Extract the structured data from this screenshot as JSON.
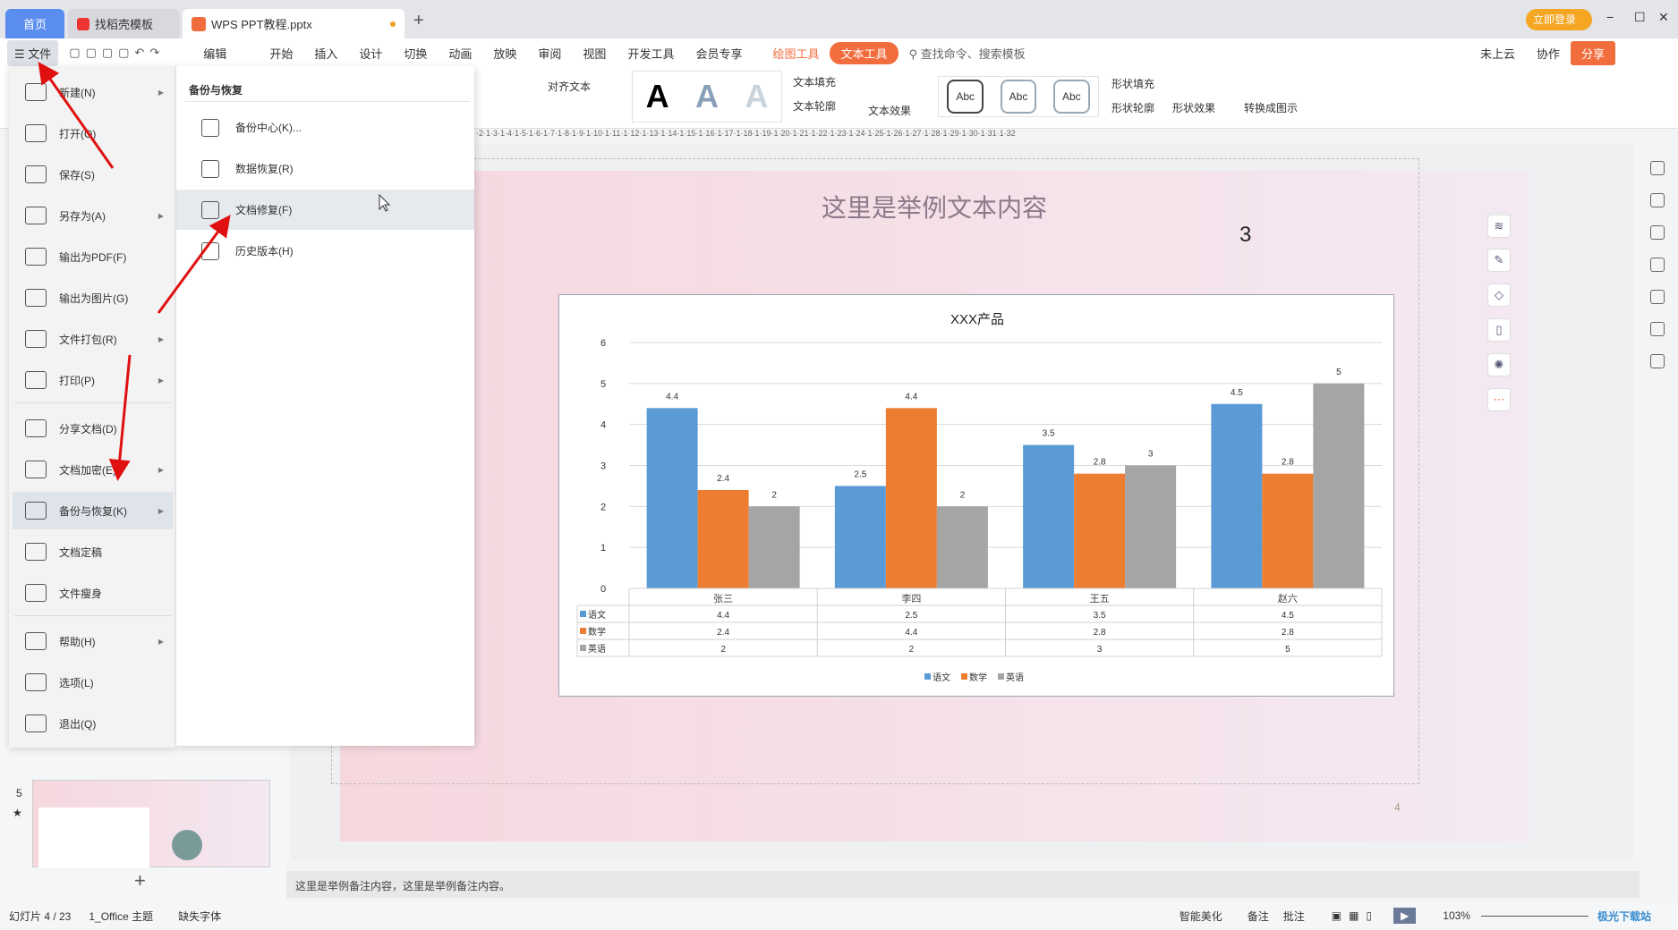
{
  "tabs": {
    "home": "首页",
    "template": "找稻壳模板",
    "doc": "WPS PPT教程.pptx",
    "new_tab": "+"
  },
  "window": {
    "login": "立即登录",
    "minimize": "−",
    "maximize": "☐",
    "close": "✕"
  },
  "menubar": {
    "file": "文件",
    "edit": "编辑",
    "items": [
      "开始",
      "插入",
      "设计",
      "切换",
      "动画",
      "放映",
      "审阅",
      "视图",
      "开发工具",
      "会员专享"
    ],
    "drawing_tools": "绘图工具",
    "text_tools": "文本工具",
    "search": "查找命令、搜索模板",
    "cloud": "未上云",
    "collab": "协作",
    "share": "分享"
  },
  "ribbon": {
    "align_text": "对齐文本",
    "text_fill": "文本填充",
    "text_outline": "文本轮廓",
    "text_effect": "文本效果",
    "styles": [
      "Abc",
      "Abc",
      "Abc"
    ],
    "shape_fill": "形状填充",
    "shape_outline": "形状轮廓",
    "shape_effect": "形状效果",
    "convert": "转换成图示",
    "big_a": "A"
  },
  "ruler": "·2·1·3·1·4·1·5·1·6·1·7·1·8·1·9·1·10·1·11·1·12·1·13·1·14·1·15·1·16·1·17·1·18·1·19·1·20·1·21·1·22·1·23·1·24·1·25·1·26·1·27·1·28·1·29·1·30·1·31·1·32",
  "file_menu": {
    "items": [
      {
        "label": "新建(N)",
        "arrow": true
      },
      {
        "label": "打开(O)"
      },
      {
        "label": "保存(S)"
      },
      {
        "label": "另存为(A)",
        "arrow": true
      },
      {
        "label": "输出为PDF(F)"
      },
      {
        "label": "输出为图片(G)"
      },
      {
        "label": "文件打包(R)",
        "arrow": true
      },
      {
        "label": "打印(P)",
        "arrow": true
      },
      {
        "label": "分享文档(D)"
      },
      {
        "label": "文档加密(E)",
        "arrow": true
      },
      {
        "label": "备份与恢复(K)",
        "arrow": true,
        "active": true
      },
      {
        "label": "文档定稿"
      },
      {
        "label": "文件瘦身"
      },
      {
        "label": "帮助(H)",
        "arrow": true
      },
      {
        "label": "选项(L)"
      },
      {
        "label": "退出(Q)"
      }
    ]
  },
  "submenu": {
    "title": "备份与恢复",
    "items": [
      "备份中心(K)...",
      "数据恢复(R)",
      "文档修复(F)",
      "历史版本(H)"
    ],
    "hovered": 2
  },
  "slide": {
    "title": "这里是举例文本内容",
    "number_text": "3",
    "page_num": "4"
  },
  "thumbnail": {
    "number": "5",
    "star": "★"
  },
  "add_slide": "+",
  "notes": "这里是举例备注内容，这里是举例备注内容。",
  "status": {
    "slide": "幻灯片 4 / 23",
    "theme": "1_Office 主题",
    "missing_font": "缺失字体",
    "beautify": "智能美化",
    "notes": "备注",
    "comment": "批注",
    "zoom": "103%"
  },
  "watermark": "极光下载站",
  "colors": {
    "blue": "#5b9bd5",
    "orange": "#ed7d31",
    "gray": "#a5a5a5",
    "accent": "#f26d3d",
    "tab_home": "#5b8def"
  },
  "chart_data": {
    "type": "bar",
    "title": "XXX产品",
    "categories": [
      "张三",
      "李四",
      "王五",
      "赵六"
    ],
    "series": [
      {
        "name": "语文",
        "values": [
          4.4,
          2.5,
          3.5,
          4.5
        ]
      },
      {
        "name": "数学",
        "values": [
          2.4,
          4.4,
          2.8,
          2.8
        ]
      },
      {
        "name": "英语",
        "values": [
          2,
          2,
          3,
          5
        ]
      }
    ],
    "ylim": [
      0,
      6
    ],
    "yticks": [
      0,
      1,
      2,
      3,
      4,
      5,
      6
    ],
    "grid": true,
    "legend": "bottom",
    "data_table": true,
    "data_labels": true
  }
}
